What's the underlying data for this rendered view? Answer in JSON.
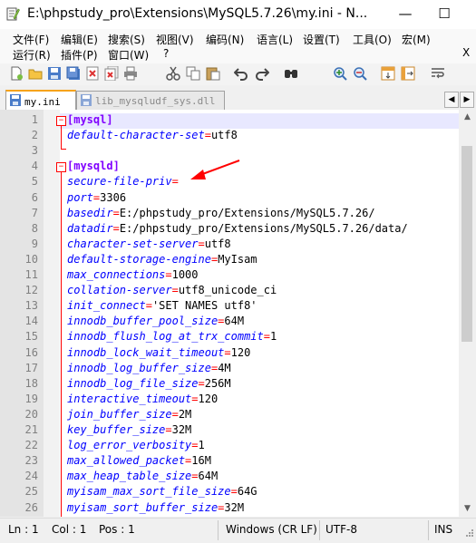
{
  "window": {
    "title": "E:\\phpstudy_pro\\Extensions\\MySQL5.7.26\\my.ini - N...",
    "minimize_glyph": "—",
    "maximize_glyph": "☐"
  },
  "menu": {
    "row1": [
      "文件(F)",
      "编辑(E)",
      "搜索(S)",
      "视图(V)",
      "编码(N)",
      "语言(L)",
      "设置(T)",
      "工具(O)",
      "宏(M)"
    ],
    "row2": [
      "运行(R)",
      "插件(P)",
      "窗口(W)",
      "?"
    ],
    "close_glyph": "X"
  },
  "toolbar": {
    "icons": [
      "new-file-icon",
      "open-file-icon",
      "save-icon",
      "save-all-icon",
      "close-file-icon",
      "close-all-icon",
      "print-icon",
      "cut-icon",
      "copy-icon",
      "paste-icon",
      "undo-icon",
      "redo-icon",
      "find-icon",
      "zoom-in-icon",
      "zoom-out-icon",
      "sync-vertical-icon",
      "sync-horizontal-icon",
      "word-wrap-icon"
    ]
  },
  "tabs": [
    {
      "label": "my.ini",
      "active": true
    },
    {
      "label": "lib_mysqludf_sys.dll",
      "active": false
    }
  ],
  "tabnav": {
    "prev": "◀",
    "next": "▶"
  },
  "editor": {
    "lines": [
      {
        "num": "1",
        "section": "[mysql]"
      },
      {
        "num": "2",
        "key": "default-character-set",
        "eq": "=",
        "value": "utf8"
      },
      {
        "num": "3"
      },
      {
        "num": "4",
        "section": "[mysqld]"
      },
      {
        "num": "5",
        "key": "secure-file-priv",
        "eq": "=",
        "value": ""
      },
      {
        "num": "6",
        "key": "port",
        "eq": "=",
        "value": "3306"
      },
      {
        "num": "7",
        "key": "basedir",
        "eq": "=",
        "value": "E:/phpstudy_pro/Extensions/MySQL5.7.26/"
      },
      {
        "num": "8",
        "key": "datadir",
        "eq": "=",
        "value": "E:/phpstudy_pro/Extensions/MySQL5.7.26/data/"
      },
      {
        "num": "9",
        "key": "character-set-server",
        "eq": "=",
        "value": "utf8"
      },
      {
        "num": "10",
        "key": "default-storage-engine",
        "eq": "=",
        "value": "MyIsam"
      },
      {
        "num": "11",
        "key": "max_connections",
        "eq": "=",
        "value": "1000"
      },
      {
        "num": "12",
        "key": "collation-server",
        "eq": "=",
        "value": "utf8_unicode_ci"
      },
      {
        "num": "13",
        "key": "init_connect",
        "eq": "=",
        "value": "'SET NAMES utf8'"
      },
      {
        "num": "14",
        "key": "innodb_buffer_pool_size",
        "eq": "=",
        "value": "64M"
      },
      {
        "num": "15",
        "key": "innodb_flush_log_at_trx_commit",
        "eq": "=",
        "value": "1"
      },
      {
        "num": "16",
        "key": "innodb_lock_wait_timeout",
        "eq": "=",
        "value": "120"
      },
      {
        "num": "17",
        "key": "innodb_log_buffer_size",
        "eq": "=",
        "value": "4M"
      },
      {
        "num": "18",
        "key": "innodb_log_file_size",
        "eq": "=",
        "value": "256M"
      },
      {
        "num": "19",
        "key": "interactive_timeout",
        "eq": "=",
        "value": "120"
      },
      {
        "num": "20",
        "key": "join_buffer_size",
        "eq": "=",
        "value": "2M"
      },
      {
        "num": "21",
        "key": "key_buffer_size",
        "eq": "=",
        "value": "32M"
      },
      {
        "num": "22",
        "key": "log_error_verbosity",
        "eq": "=",
        "value": "1"
      },
      {
        "num": "23",
        "key": "max_allowed_packet",
        "eq": "=",
        "value": "16M"
      },
      {
        "num": "24",
        "key": "max_heap_table_size",
        "eq": "=",
        "value": "64M"
      },
      {
        "num": "25",
        "key": "myisam_max_sort_file_size",
        "eq": "=",
        "value": "64G"
      },
      {
        "num": "26",
        "key": "myisam_sort_buffer_size",
        "eq": "=",
        "value": "32M"
      }
    ],
    "fold_open_glyph": "−"
  },
  "scrollbar": {
    "up": "▲",
    "down": "▼"
  },
  "status": {
    "ln": "Ln : 1",
    "col": "Col : 1",
    "pos": "Pos : 1",
    "eol": "Windows (CR LF)",
    "encoding": "UTF-8",
    "mode": "INS"
  },
  "colors": {
    "section": "#8000ff",
    "key": "#0000ff",
    "equals": "#ff0000",
    "annotation_arrow": "#ff0000",
    "active_tab_accent": "#f6a31b"
  }
}
